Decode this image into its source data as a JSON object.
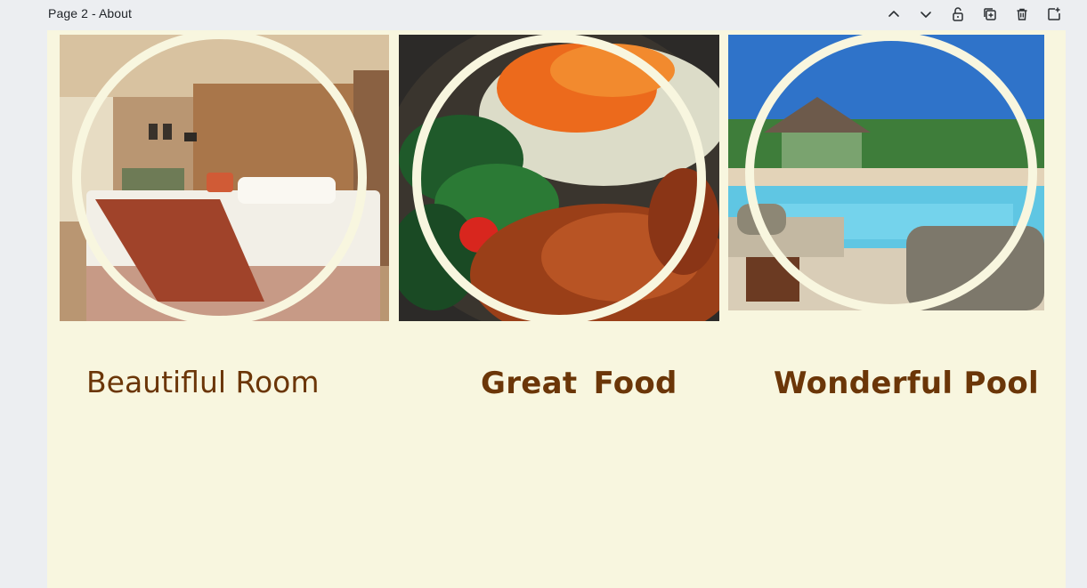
{
  "header": {
    "page_title": "Page 2 - About"
  },
  "toolbar": {
    "icons": [
      "chevron-up-icon",
      "chevron-down-icon",
      "lock-open-icon",
      "duplicate-icon",
      "trash-icon",
      "add-page-icon"
    ]
  },
  "colors": {
    "canvas_bg": "#f8f6df",
    "caption": "#6b3608",
    "workspace_bg": "#eceef1"
  },
  "features": [
    {
      "caption": "Beautiflul Room",
      "photo": "hotel bedroom"
    },
    {
      "caption": "Great  Food",
      "photo": "grilled chicken salad"
    },
    {
      "caption": "Wonderful Pool",
      "photo": "resort swimming pool"
    }
  ]
}
